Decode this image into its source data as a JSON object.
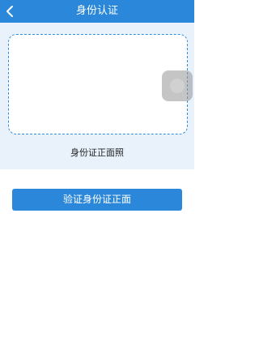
{
  "header": {
    "title": "身份认证",
    "back_icon": "chevron-left-icon"
  },
  "id_capture": {
    "caption": "身份证正面照"
  },
  "actions": {
    "verify_label": "验证身份证正面"
  },
  "colors": {
    "primary": "#2b87d9",
    "panel_bg": "#e9f2fb",
    "frame_dash": "#2f8ee0"
  }
}
